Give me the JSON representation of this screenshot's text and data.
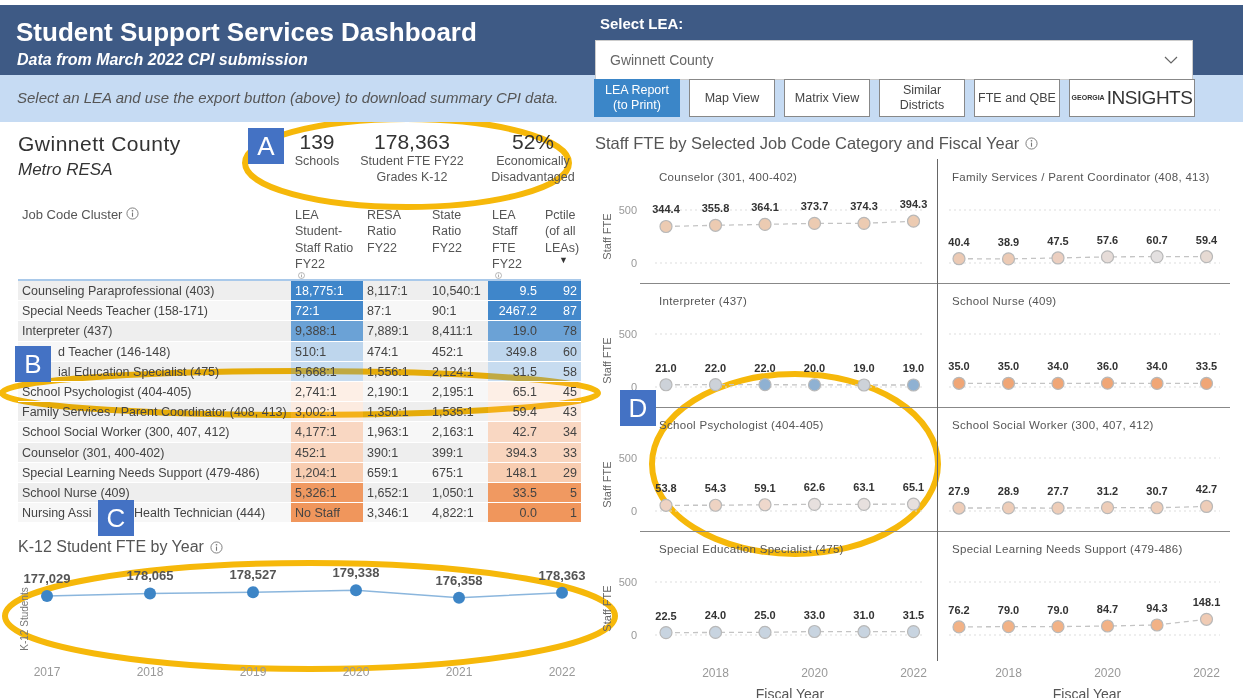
{
  "header": {
    "title": "Student Support Services Dashboard",
    "subtitle": "Data from March 2022 CPI submission",
    "hint": "Select an LEA and use the export button (above) to download summary CPI data."
  },
  "lea_select": {
    "label": "Select LEA:",
    "value": "Gwinnett County"
  },
  "nav_buttons": [
    {
      "label": "LEA Report (to Print)",
      "kind": "text",
      "selected": true
    },
    {
      "label": "Map View",
      "kind": "text",
      "selected": false
    },
    {
      "label": "Matrix View",
      "kind": "text",
      "selected": false
    },
    {
      "label": "Similar Districts",
      "kind": "text",
      "selected": false
    },
    {
      "label": "FTE and QBE",
      "kind": "text",
      "selected": false
    },
    {
      "label": "INSIGHTS",
      "prefix": "GEORGIA",
      "kind": "logo",
      "selected": false
    }
  ],
  "district": {
    "name": "Gwinnett County",
    "region": "Metro RESA"
  },
  "kpis": [
    {
      "value": "139",
      "label_lines": [
        "Schools"
      ]
    },
    {
      "value": "178,363",
      "label_lines": [
        "Student FTE FY22",
        "Grades K-12"
      ]
    },
    {
      "value": "52%",
      "label_lines": [
        "Economically",
        "Disadvantaged"
      ]
    }
  ],
  "table": {
    "title": "Job Code Cluster",
    "columns": [
      {
        "label": "LEA Student-Staff Ratio FY22",
        "info": true
      },
      {
        "label": "RESA Ratio FY22"
      },
      {
        "label": "State Ratio FY22"
      },
      {
        "label": "LEA Staff FTE FY22",
        "info": true
      },
      {
        "label": "Pctile (of all LEAs)",
        "sort_marker": "▼"
      }
    ],
    "rows": [
      {
        "label": "Counseling Paraprofessional (403)",
        "cells": [
          "18,775:1",
          "8,117:1",
          "10,540:1",
          "9.5",
          "92"
        ]
      },
      {
        "label": "Special Needs Teacher (158-171)",
        "cells": [
          "72:1",
          "87:1",
          "90:1",
          "2467.2",
          "87"
        ]
      },
      {
        "label": "Interpreter (437)",
        "cells": [
          "9,388:1",
          "7,889:1",
          "8,411:1",
          "19.0",
          "78"
        ]
      },
      {
        "label": "d Teacher (146-148)",
        "cells": [
          "510:1",
          "474:1",
          "452:1",
          "349.8",
          "60"
        ]
      },
      {
        "label": "ial Education Specialist (475)",
        "cells": [
          "5,668:1",
          "1,556:1",
          "2,124:1",
          "31.5",
          "58"
        ]
      },
      {
        "label": "School Psychologist (404-405)",
        "cells": [
          "2,741:1",
          "2,190:1",
          "2,195:1",
          "65.1",
          "45"
        ]
      },
      {
        "label": "Family Services / Parent Coordinator (408, 413)",
        "cells": [
          "3,002:1",
          "1,350:1",
          "1,535:1",
          "59.4",
          "43"
        ]
      },
      {
        "label": "School Social Worker (300, 407, 412)",
        "cells": [
          "4,177:1",
          "1,963:1",
          "2,163:1",
          "42.7",
          "34"
        ]
      },
      {
        "label": "Counselor (301, 400-402)",
        "cells": [
          "452:1",
          "390:1",
          "399:1",
          "394.3",
          "33"
        ]
      },
      {
        "label": "Special Learning Needs Support (479-486)",
        "cells": [
          "1,204:1",
          "659:1",
          "675:1",
          "148.1",
          "29"
        ]
      },
      {
        "label": "School Nurse (409)",
        "cells": [
          "5,326:1",
          "1,652:1",
          "1,050:1",
          "33.5",
          "5"
        ]
      },
      {
        "label_parts": [
          "Nursing Assi",
          "Health Technician (444)"
        ],
        "cells": [
          "No Staff",
          "3,346:1",
          "4,822:1",
          "0.0",
          "1"
        ]
      }
    ]
  },
  "k12_chart": {
    "chart_data": {
      "type": "line",
      "title": "K-12 Student FTE by Year",
      "ylabel": "K-12 Students",
      "categories": [
        "2017",
        "2018",
        "2019",
        "2020",
        "2021",
        "2022"
      ],
      "series": [
        {
          "color": "#3d85c6",
          "marker": "circle",
          "values": [
            177029,
            178065,
            178527,
            179338,
            176358,
            178363
          ],
          "value_labels": [
            "177,029",
            "178,065",
            "178,527",
            "179,338",
            "176,358",
            "178,363"
          ]
        }
      ]
    }
  },
  "staff_title": "Staff FTE by Selected Job Code Category and Fiscal Year",
  "panels": [
    {
      "title": "Counselor (301, 400-402)",
      "y_axis": {
        "title": "Staff FTE",
        "ticks": [
          "500",
          "0"
        ]
      },
      "points": [
        {
          "label": "344.4",
          "color": "#eccbb2"
        },
        {
          "label": "355.8",
          "color": "#eccbb2"
        },
        {
          "label": "364.1",
          "color": "#eccbb2"
        },
        {
          "label": "373.7",
          "color": "#eccbb2"
        },
        {
          "label": "374.3",
          "color": "#eccbb2"
        },
        {
          "label": "394.3",
          "color": "#eccbb2"
        }
      ]
    },
    {
      "title": "Family Services / Parent Coordinator (408, 413)",
      "points": [
        {
          "label": "40.4",
          "color": "#eccab4"
        },
        {
          "label": "38.9",
          "color": "#eccab4"
        },
        {
          "label": "47.5",
          "color": "#eccfc0"
        },
        {
          "label": "57.6",
          "color": "#e6dcd8"
        },
        {
          "label": "60.7",
          "color": "#e3e0e0"
        },
        {
          "label": "59.4",
          "color": "#e6dad3"
        }
      ]
    },
    {
      "title": "Interpreter (437)",
      "y_axis": {
        "title": "Staff FTE",
        "ticks": [
          "500",
          "0"
        ]
      },
      "points": [
        {
          "label": "21.0",
          "color": "#cdd2d9"
        },
        {
          "label": "22.0",
          "color": "#cdd2d9"
        },
        {
          "label": "22.0",
          "color": "#8fb1d2"
        },
        {
          "label": "20.0",
          "color": "#8fb1d2"
        },
        {
          "label": "19.0",
          "color": "#cdd2d9"
        },
        {
          "label": "19.0",
          "color": "#8fb1d2"
        }
      ]
    },
    {
      "title": "School Nurse (409)",
      "points": [
        {
          "label": "35.0",
          "color": "#f0a676"
        },
        {
          "label": "35.0",
          "color": "#f0a676"
        },
        {
          "label": "34.0",
          "color": "#f0a676"
        },
        {
          "label": "36.0",
          "color": "#f0a676"
        },
        {
          "label": "34.0",
          "color": "#f0a676"
        },
        {
          "label": "33.5",
          "color": "#f0a676"
        }
      ]
    },
    {
      "title": "School Psychologist (404-405)",
      "y_axis": {
        "title": "Staff FTE",
        "ticks": [
          "500",
          "0"
        ]
      },
      "points": [
        {
          "label": "53.8",
          "color": "#eed3c3"
        },
        {
          "label": "54.3",
          "color": "#eed3c3"
        },
        {
          "label": "59.1",
          "color": "#eed8cc"
        },
        {
          "label": "62.6",
          "color": "#e7e0de"
        },
        {
          "label": "63.1",
          "color": "#e7e0de"
        },
        {
          "label": "65.1",
          "color": "#e7e0de"
        }
      ]
    },
    {
      "title": "School Social Worker (300, 407, 412)",
      "points": [
        {
          "label": "27.9",
          "color": "#eecdb8"
        },
        {
          "label": "28.9",
          "color": "#eecdb8"
        },
        {
          "label": "27.7",
          "color": "#eecdb8"
        },
        {
          "label": "31.2",
          "color": "#eecdb8"
        },
        {
          "label": "30.7",
          "color": "#eecdb8"
        },
        {
          "label": "42.7",
          "color": "#eecdb8"
        }
      ]
    },
    {
      "title": "Special Education Specialist (475)",
      "y_axis": {
        "title": "Staff FTE",
        "ticks": [
          "500",
          "0"
        ]
      },
      "x_axis": {
        "title": "Fiscal Year",
        "ticks": [
          "2018",
          "2020",
          "2022"
        ]
      },
      "points": [
        {
          "label": "22.5",
          "color": "#c8d4e0"
        },
        {
          "label": "24.0",
          "color": "#c8d4e0"
        },
        {
          "label": "25.0",
          "color": "#c8d4e0"
        },
        {
          "label": "33.0",
          "color": "#c8d4e0"
        },
        {
          "label": "31.0",
          "color": "#c8d4e0"
        },
        {
          "label": "31.5",
          "color": "#c8d4e0"
        }
      ]
    },
    {
      "title": "Special Learning Needs Support (479-486)",
      "x_axis": {
        "title": "Fiscal Year",
        "ticks": [
          "2018",
          "2020",
          "2022"
        ]
      },
      "points": [
        {
          "label": "76.2",
          "color": "#f2b286"
        },
        {
          "label": "79.0",
          "color": "#f2b286"
        },
        {
          "label": "79.0",
          "color": "#f2b286"
        },
        {
          "label": "84.7",
          "color": "#f2b286"
        },
        {
          "label": "94.3",
          "color": "#f2b286"
        },
        {
          "label": "148.1",
          "color": "#f0cbb4"
        }
      ]
    }
  ],
  "callouts": [
    {
      "letter": "A"
    },
    {
      "letter": "B"
    },
    {
      "letter": "C"
    },
    {
      "letter": "D"
    }
  ]
}
